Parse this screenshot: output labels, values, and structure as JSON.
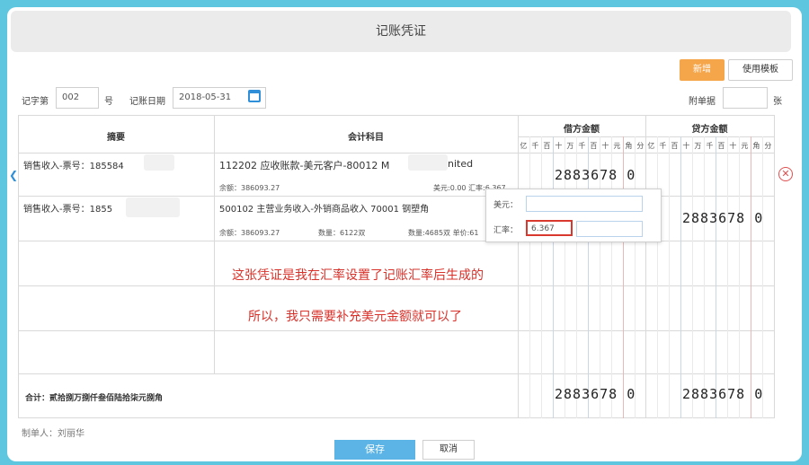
{
  "window": {
    "title": "记账凭证"
  },
  "toolbar": {
    "new_label": "新增",
    "template_label": "使用模板"
  },
  "header": {
    "voucher_word_label": "记字第",
    "voucher_no": "002",
    "voucher_no_suffix": "号",
    "date_label": "记账日期",
    "date_value": "2018-05-31",
    "attachments_label": "附单据",
    "attachments_value": "",
    "attachments_suffix": "张"
  },
  "table": {
    "col_summary": "摘要",
    "col_account": "会计科目",
    "col_debit": "借方金额",
    "col_credit": "贷方金额",
    "digit_headers": [
      "亿",
      "千",
      "百",
      "十",
      "万",
      "千",
      "百",
      "十",
      "元",
      "角",
      "分"
    ],
    "rows": [
      {
        "summary": "销售收入-票号：185584",
        "account": "112202 应收账款-美元客户-80012 M",
        "account_tail": "nited",
        "balance": "余额：386093.27",
        "fx_info": "美元:0.00 汇率:6.367",
        "debit": "2883678 0",
        "credit": ""
      },
      {
        "summary": "销售收入-票号：1855",
        "account": "500102 主营业务收入-外销商品收入 70001 钢塑角",
        "balance": "余额：386093.27",
        "qty": "数量：6122双",
        "qty2": "数量:4685双 单价:61",
        "debit": "",
        "credit": "2883678 0"
      }
    ],
    "total_label": "合计：贰拾捌万捌仟叁佰陆拾柒元捌角",
    "total_debit": "2883678 0",
    "total_credit": "2883678 0"
  },
  "popup": {
    "usd_label": "美元：",
    "usd_value": "",
    "rate_label": "汇率：",
    "rate_value": "6.367"
  },
  "annotations": {
    "line1": "这张凭证是我在汇率设置了记账汇率后生成的",
    "line2": "所以，我只需要补充美元金额就可以了"
  },
  "footer": {
    "preparer_label": "制单人：",
    "preparer_value": "刘丽华",
    "save_label": "保存",
    "cancel_label": "取消"
  }
}
